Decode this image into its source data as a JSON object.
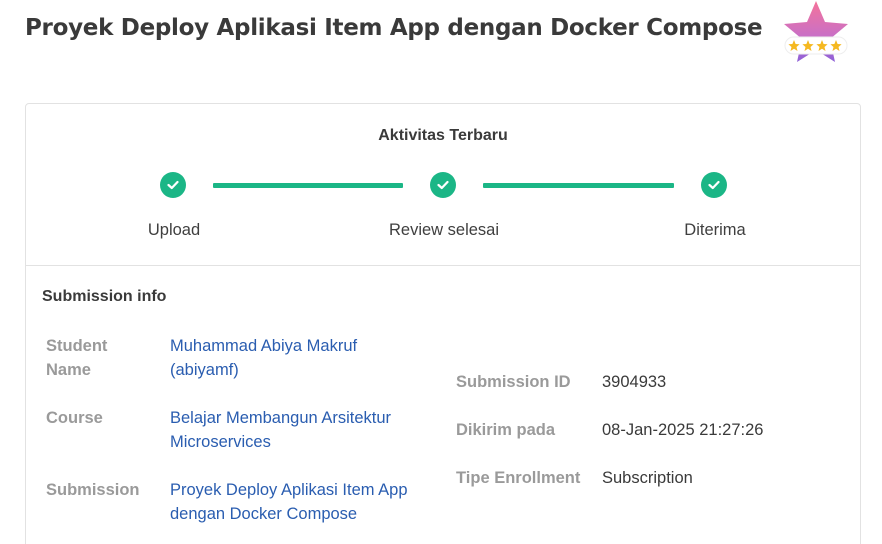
{
  "page": {
    "title": "Proyek Deploy Aplikasi Item App dengan Docker Compose"
  },
  "badge": {
    "icon": "star-rating-badge-icon",
    "stars": 4,
    "colors": {
      "star_top": "#ef6ba0",
      "star_bottom": "#b06ad8",
      "ribbon": "#ffffff",
      "mini_star": "#f5b820"
    }
  },
  "activity": {
    "title": "Aktivitas Terbaru",
    "accent": "#1bb686",
    "steps": [
      {
        "label": "Upload",
        "icon": "check-icon",
        "done": true
      },
      {
        "label": "Review selesai",
        "icon": "check-icon",
        "done": true
      },
      {
        "label": "Diterima",
        "icon": "check-icon",
        "done": true
      }
    ]
  },
  "submission": {
    "title": "Submission info",
    "student_label": "Student Name",
    "student_value_line1": "Muhammad Abiya Makruf",
    "student_value_line2": "(abiyamf)",
    "course_label": "Course",
    "course_value_line1": "Belajar Membangun Arsitektur",
    "course_value_line2": "Microservices",
    "submission_label": "Submission",
    "submission_value_line1": "Proyek Deploy Aplikasi Item App",
    "submission_value_line2": "dengan Docker Compose",
    "submission_id_label": "Submission ID",
    "submission_id_value": "3904933",
    "sent_label": "Dikirim pada",
    "sent_value": "08-Jan-2025 21:27:26",
    "enrollment_label": "Tipe Enrollment",
    "enrollment_value": "Subscription",
    "link_color": "#2a5db0"
  }
}
